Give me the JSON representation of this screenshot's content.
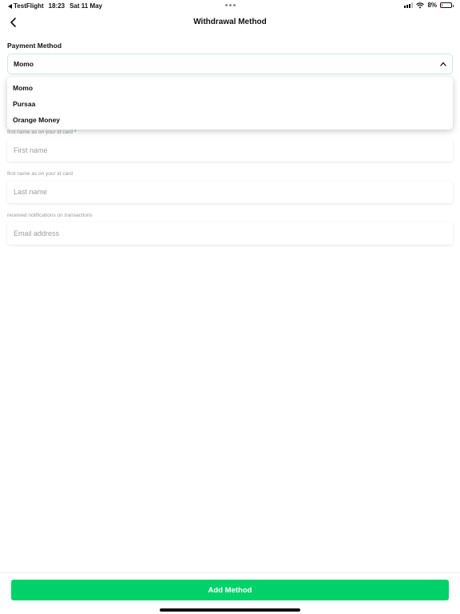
{
  "status_bar": {
    "app": "TestFlight",
    "time": "18:23",
    "date": "Sat 11 May",
    "battery": "8%",
    "battery_level": 0.08
  },
  "header": {
    "title": "Withdrawal Method"
  },
  "payment": {
    "label": "Payment Method",
    "selected": "Momo",
    "options": [
      "Momo",
      "Pursaa",
      "Orange Money"
    ]
  },
  "form": {
    "first_name": {
      "hint": "first name as on your id card",
      "required_mark": "*",
      "placeholder": "First name"
    },
    "last_name": {
      "hint": "first name as on your id card",
      "placeholder": "Last name"
    },
    "email": {
      "hint": "received notifications on transactions",
      "placeholder": "Email address"
    }
  },
  "footer": {
    "button_label": "Add Method"
  },
  "colors": {
    "accent": "#00d26a",
    "battery_low": "#e53935"
  }
}
